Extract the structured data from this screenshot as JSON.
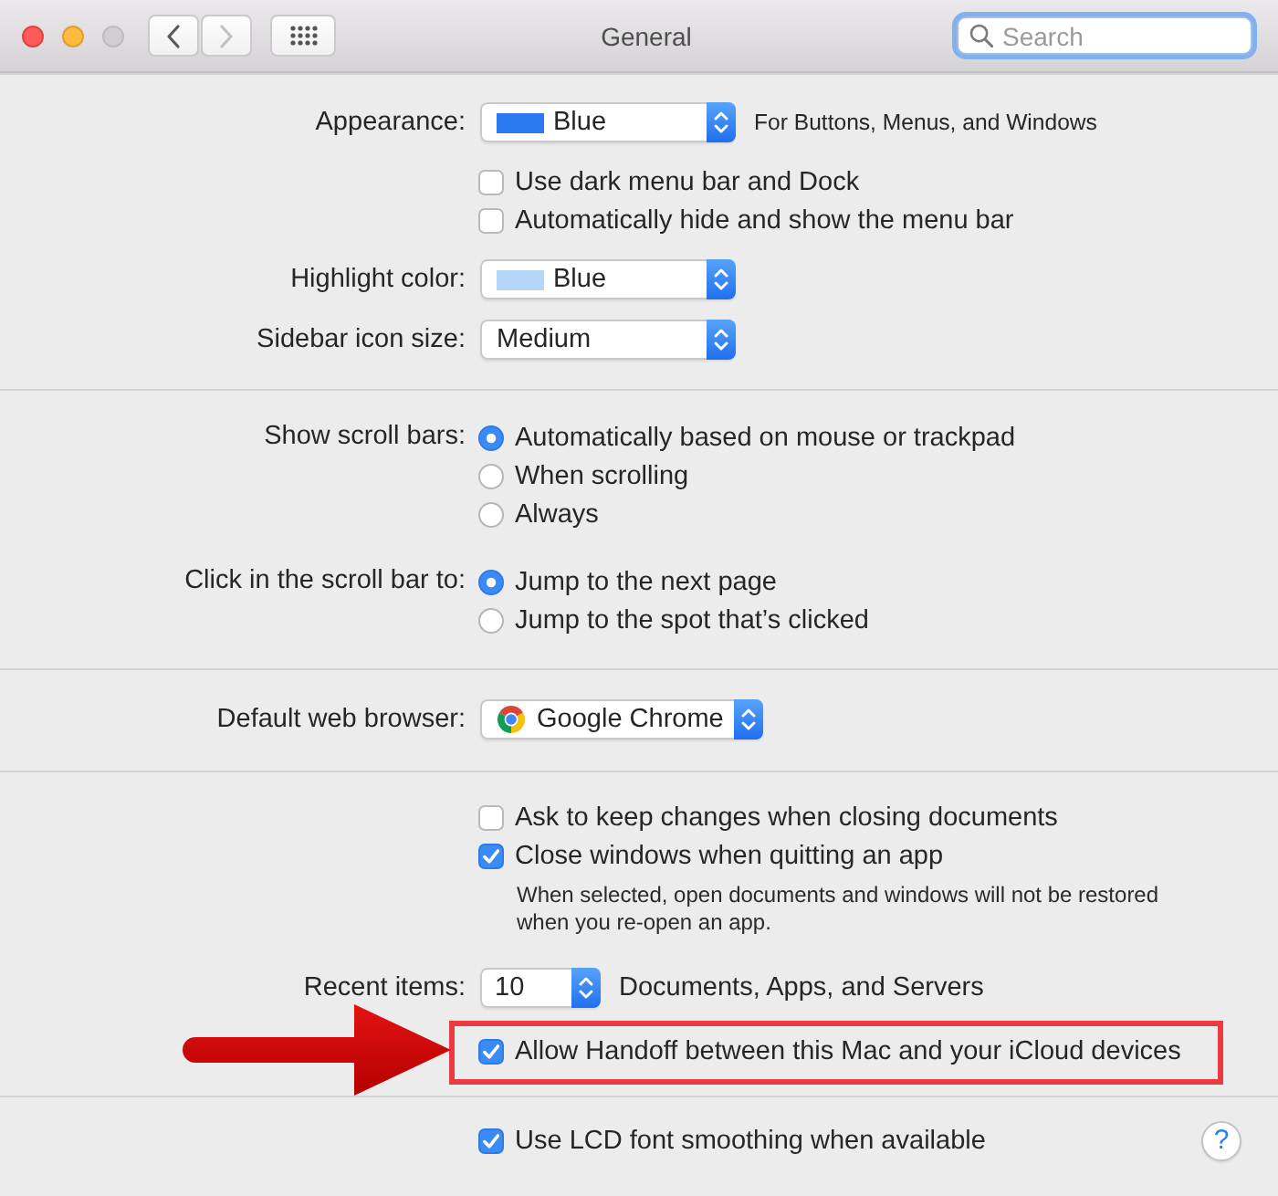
{
  "window": {
    "title": "General"
  },
  "window_controls": [
    {
      "kind": "close",
      "disabled": false
    },
    {
      "kind": "minimize",
      "disabled": false
    },
    {
      "kind": "zoom",
      "disabled": true
    }
  ],
  "toolbar": {
    "back": {
      "disabled": false
    },
    "forward": {
      "disabled": true
    },
    "search": {
      "placeholder": "Search"
    }
  },
  "sections": [
    {
      "rows": [
        {
          "kind": "popup",
          "label": "Appearance:",
          "color": "#2b7bee",
          "value": "Blue",
          "hint": "For Buttons, Menus, and Windows"
        },
        {
          "kind": "checkbox",
          "text": "Use dark menu bar and Dock",
          "checked": false,
          "highlighted": false
        },
        {
          "kind": "checkbox",
          "text": "Automatically hide and show the menu bar",
          "checked": false,
          "highlighted": false
        },
        {
          "kind": "popup",
          "label": "Highlight color:",
          "color": "#b5d5f9",
          "value": "Blue"
        },
        {
          "kind": "popup",
          "label": "Sidebar icon size:",
          "value": "Medium"
        }
      ]
    },
    {
      "rows": [
        {
          "kind": "radio_group",
          "label": "Show scroll bars:",
          "options": [
            {
              "text": "Automatically based on mouse or trackpad",
              "selected": true
            },
            {
              "text": "When scrolling",
              "selected": false
            },
            {
              "text": "Always",
              "selected": false
            }
          ]
        },
        {
          "kind": "radio_group",
          "label": "Click in the scroll bar to:",
          "options": [
            {
              "text": "Jump to the next page",
              "selected": true
            },
            {
              "text": "Jump to the spot that’s clicked",
              "selected": false
            }
          ]
        }
      ]
    },
    {
      "rows": [
        {
          "kind": "browser_popup",
          "label": "Default web browser:",
          "value": "Google Chrome"
        }
      ]
    },
    {
      "rows": [
        {
          "kind": "checkbox",
          "text": "Ask to keep changes when closing documents",
          "checked": false,
          "highlighted": false
        },
        {
          "kind": "checkbox",
          "text": "Close windows when quitting an app",
          "checked": true,
          "highlighted": false
        },
        {
          "kind": "note",
          "text": "When selected, open documents and windows will not be restored when you re-open an app."
        },
        {
          "kind": "combo",
          "label": "Recent items:",
          "value": "10",
          "suffix": "Documents, Apps, and Servers"
        },
        {
          "kind": "checkbox",
          "text": "Allow Handoff between this Mac and your iCloud devices",
          "checked": true,
          "highlighted": true
        }
      ]
    },
    {
      "rows": [
        {
          "kind": "checkbox",
          "text": "Use LCD font smoothing when available",
          "checked": true,
          "highlighted": false
        }
      ]
    }
  ],
  "help_button": {
    "label": "?"
  }
}
